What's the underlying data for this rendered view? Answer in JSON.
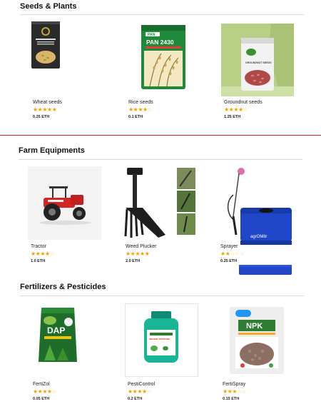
{
  "sections": [
    {
      "title": "Seeds & Plants",
      "products": [
        {
          "name": "Wheat seeds",
          "rating": 5,
          "price": "0.25 ETH",
          "image": "wheat-seed-pack-icon"
        },
        {
          "name": "Rice seeds",
          "rating": 4,
          "price": "0.1 ETH",
          "image": "rice-seed-pack-icon",
          "pack_label": "PAN 2430",
          "pack_brand": "PAN"
        },
        {
          "name": "Groundnut seeds",
          "rating": 4,
          "price": "1.25 ETH",
          "image": "groundnut-seed-pouch-icon",
          "pack_label": "GROUNDNUT SEEDS"
        }
      ]
    },
    {
      "title": "Farm Equipments",
      "products": [
        {
          "name": "Tractor",
          "rating": 4,
          "price": "1.0 ETH",
          "image": "red-tractor-icon"
        },
        {
          "name": "Weed Plucker",
          "rating": 5,
          "price": "2.0 ETH",
          "image": "weed-plucker-tool-icon"
        },
        {
          "name": "Sprayer",
          "rating": 2,
          "price": "0.25 ETH",
          "image": "backpack-sprayer-icon",
          "brand": "agrOMitr"
        }
      ]
    },
    {
      "title": "Fertilizers & Pesticides",
      "products": [
        {
          "name": "FertiZol",
          "rating": 4,
          "price": "0.05 ETH",
          "image": "dap-fertilizer-bag-icon",
          "pack_label": "DAP"
        },
        {
          "name": "PestiControl",
          "rating": 4,
          "price": "0.2 ETH",
          "image": "pesticide-bottle-icon",
          "pack_label": "ORGANIC PESTICIDE"
        },
        {
          "name": "FertiSpray",
          "rating": 3,
          "price": "0.15 ETH",
          "image": "npk-fertilizer-bag-icon",
          "pack_label": "NPK"
        }
      ]
    }
  ],
  "colors": {
    "star": "#f2a000",
    "divider": "#d8d8d8",
    "accent_rule": "#b02a2a"
  }
}
